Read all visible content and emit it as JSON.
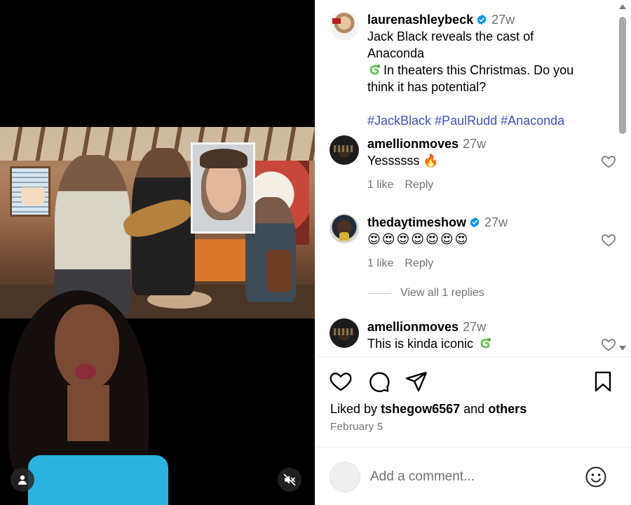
{
  "post": {
    "author": "laurenashleybeck",
    "verified": true,
    "time": "27w",
    "caption_line1": "Jack Black reveals the cast of Anaconda",
    "caption_line2": "In theaters this Christmas. Do you",
    "caption_line3": "think it has potential?",
    "hashtags": [
      "#JackBlack",
      "#PaulRudd",
      "#Anaconda"
    ],
    "liked_by_prefix": "Liked by",
    "liked_by_user": "tshegow6567",
    "liked_by_and": "and",
    "liked_by_others": "others",
    "date": "February 5"
  },
  "comments": [
    {
      "username": "amellionmoves",
      "time": "27w",
      "text": "Yessssss 🔥",
      "likes": "1 like",
      "reply": "Reply"
    },
    {
      "username": "thedaytimeshow",
      "verified": true,
      "time": "27w",
      "text": "😍😍😍😍😍😍😍",
      "likes": "1 like",
      "reply": "Reply",
      "view_replies": "View all 1 replies"
    },
    {
      "username": "amellionmoves",
      "time": "27w",
      "text": "This is kinda iconic"
    }
  ],
  "composer": {
    "placeholder": "Add a comment..."
  },
  "colors": {
    "verified": "#0095f6",
    "hashtag": "#4151c4",
    "muted_text": "#737373"
  },
  "icons": {
    "like": "heart-icon",
    "comment": "comment-icon",
    "share": "share-icon",
    "save": "bookmark-icon",
    "emoji": "smiley-icon",
    "mute": "speaker-muted-icon",
    "tags": "user-tag-icon"
  }
}
